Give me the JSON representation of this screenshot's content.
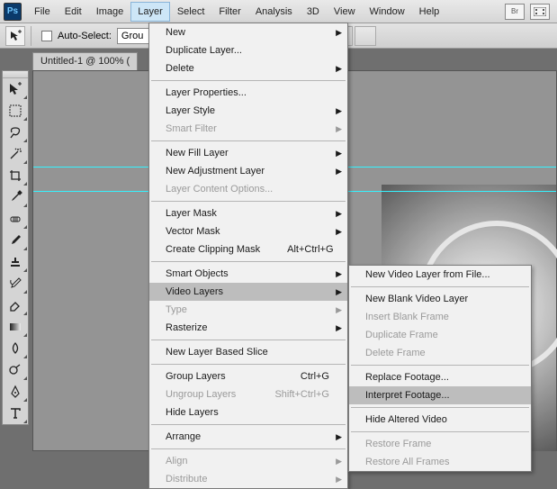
{
  "app_icon": "Ps",
  "menubar": [
    "File",
    "Edit",
    "Image",
    "Layer",
    "Select",
    "Filter",
    "Analysis",
    "3D",
    "View",
    "Window",
    "Help"
  ],
  "menubar_open_index": 3,
  "right_icons": [
    "Br",
    "film"
  ],
  "optbar": {
    "auto_select_label": "Auto-Select:",
    "combo_value": "Grou"
  },
  "tab_label": "Untitled-1 @ 100% (",
  "layer_menu": [
    {
      "t": "item",
      "label": "New",
      "sub": true
    },
    {
      "t": "item",
      "label": "Duplicate Layer..."
    },
    {
      "t": "item",
      "label": "Delete",
      "sub": true
    },
    {
      "t": "sep"
    },
    {
      "t": "item",
      "label": "Layer Properties..."
    },
    {
      "t": "item",
      "label": "Layer Style",
      "sub": true
    },
    {
      "t": "item",
      "label": "Smart Filter",
      "disabled": true,
      "sub": true
    },
    {
      "t": "sep"
    },
    {
      "t": "item",
      "label": "New Fill Layer",
      "sub": true
    },
    {
      "t": "item",
      "label": "New Adjustment Layer",
      "sub": true
    },
    {
      "t": "item",
      "label": "Layer Content Options...",
      "disabled": true
    },
    {
      "t": "sep"
    },
    {
      "t": "item",
      "label": "Layer Mask",
      "sub": true
    },
    {
      "t": "item",
      "label": "Vector Mask",
      "sub": true
    },
    {
      "t": "item",
      "label": "Create Clipping Mask",
      "shortcut": "Alt+Ctrl+G"
    },
    {
      "t": "sep"
    },
    {
      "t": "item",
      "label": "Smart Objects",
      "sub": true
    },
    {
      "t": "item",
      "label": "Video Layers",
      "sub": true,
      "highlight": true
    },
    {
      "t": "item",
      "label": "Type",
      "disabled": true,
      "sub": true
    },
    {
      "t": "item",
      "label": "Rasterize",
      "sub": true
    },
    {
      "t": "sep"
    },
    {
      "t": "item",
      "label": "New Layer Based Slice"
    },
    {
      "t": "sep"
    },
    {
      "t": "item",
      "label": "Group Layers",
      "shortcut": "Ctrl+G"
    },
    {
      "t": "item",
      "label": "Ungroup Layers",
      "shortcut": "Shift+Ctrl+G",
      "disabled": true
    },
    {
      "t": "item",
      "label": "Hide Layers"
    },
    {
      "t": "sep"
    },
    {
      "t": "item",
      "label": "Arrange",
      "sub": true
    },
    {
      "t": "sep"
    },
    {
      "t": "item",
      "label": "Align",
      "disabled": true,
      "sub": true
    },
    {
      "t": "item",
      "label": "Distribute",
      "disabled": true,
      "sub": true
    }
  ],
  "video_submenu": [
    {
      "t": "item",
      "label": "New Video Layer from File..."
    },
    {
      "t": "sep"
    },
    {
      "t": "item",
      "label": "New Blank Video Layer"
    },
    {
      "t": "item",
      "label": "Insert Blank Frame",
      "disabled": true
    },
    {
      "t": "item",
      "label": "Duplicate Frame",
      "disabled": true
    },
    {
      "t": "item",
      "label": "Delete Frame",
      "disabled": true
    },
    {
      "t": "sep"
    },
    {
      "t": "item",
      "label": "Replace Footage..."
    },
    {
      "t": "item",
      "label": "Interpret Footage...",
      "highlight": true
    },
    {
      "t": "sep"
    },
    {
      "t": "item",
      "label": "Hide Altered Video"
    },
    {
      "t": "sep"
    },
    {
      "t": "item",
      "label": "Restore Frame",
      "disabled": true
    },
    {
      "t": "item",
      "label": "Restore All Frames",
      "disabled": true
    }
  ],
  "tools": [
    "move",
    "marquee",
    "lasso",
    "wand",
    "crop",
    "eyedrop",
    "heal",
    "brush",
    "stamp",
    "history",
    "eraser",
    "gradient",
    "blur",
    "dodge",
    "pen",
    "type"
  ]
}
